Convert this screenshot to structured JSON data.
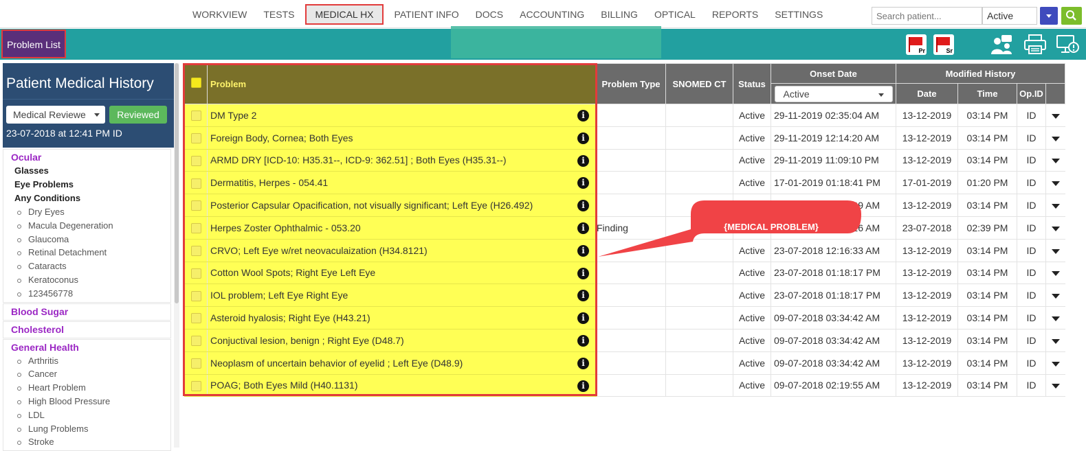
{
  "nav": {
    "items": [
      "WORKVIEW",
      "TESTS",
      "MEDICAL HX",
      "PATIENT INFO",
      "DOCS",
      "ACCOUNTING",
      "BILLING",
      "OPTICAL",
      "REPORTS",
      "SETTINGS"
    ],
    "active_index": 2,
    "search_placeholder": "Search patient...",
    "status_value": "Active"
  },
  "toolbar": {
    "problem_list_label": "Problem List",
    "flag_pr": "Pr",
    "flag_sr": "Sr"
  },
  "sidebar": {
    "title": "Patient Medical History",
    "review_dropdown": "Medical Reviewe",
    "reviewed_button": "Reviewed",
    "review_date": "23-07-2018 at 12:41 PM ID",
    "sections": [
      {
        "label": "Ocular",
        "subs": [
          "Glasses",
          "Eye Problems",
          "Any Conditions"
        ],
        "items": [
          "Dry Eyes",
          "Macula Degeneration",
          "Glaucoma",
          "Retinal Detachment",
          "Cataracts",
          "Keratoconus",
          "123456778"
        ]
      },
      {
        "label": "Blood Sugar",
        "subs": [],
        "items": []
      },
      {
        "label": "Cholesterol",
        "subs": [],
        "items": []
      },
      {
        "label": "General Health",
        "subs": [],
        "items": [
          "Arthritis",
          "Cancer",
          "Heart Problem",
          "High Blood Pressure",
          "LDL",
          "Lung Problems",
          "Stroke"
        ]
      }
    ]
  },
  "table": {
    "headers": {
      "problem": "Problem",
      "problem_type": "Problem Type",
      "snomed": "SNOMED CT",
      "status": "Status",
      "onset_date": "Onset Date",
      "modified_history": "Modified History",
      "date": "Date",
      "time": "Time",
      "opid": "Op.ID"
    },
    "onset_filter": "Active",
    "rows": [
      {
        "problem": "DM Type 2",
        "type": "",
        "snomed": "",
        "status": "Active",
        "onset": "29-11-2019 02:35:04 AM",
        "date": "13-12-2019",
        "time": "03:14 PM",
        "opid": "ID"
      },
      {
        "problem": "Foreign Body, Cornea; Both Eyes",
        "type": "",
        "snomed": "",
        "status": "Active",
        "onset": "29-11-2019 12:14:20 AM",
        "date": "13-12-2019",
        "time": "03:14 PM",
        "opid": "ID"
      },
      {
        "problem": "ARMD DRY [ICD-10: H35.31--, ICD-9: 362.51] ; Both Eyes (H35.31--)",
        "type": "",
        "snomed": "",
        "status": "Active",
        "onset": "29-11-2019 11:09:10 PM",
        "date": "13-12-2019",
        "time": "03:14 PM",
        "opid": "ID"
      },
      {
        "problem": "Dermatitis, Herpes - 054.41",
        "type": "",
        "snomed": "",
        "status": "Active",
        "onset": "17-01-2019 01:18:41 PM",
        "date": "17-01-2019",
        "time": "01:20 PM",
        "opid": "ID"
      },
      {
        "problem": "Posterior Capsular Opacification, not visually significant; Left Eye (H26.492)",
        "type": "",
        "snomed": "",
        "status": "Active",
        "onset": "23-07-2018 02:14:09 AM",
        "date": "13-12-2019",
        "time": "03:14 PM",
        "opid": "ID"
      },
      {
        "problem": "Herpes Zoster Ophthalmic - 053.20",
        "type": "Finding",
        "snomed": "",
        "status": "Active",
        "onset": "23-07-2018 12:41:26 AM",
        "date": "23-07-2018",
        "time": "02:39 PM",
        "opid": "ID"
      },
      {
        "problem": "CRVO; Left Eye w/ret neovaculaization (H34.8121)",
        "type": "",
        "snomed": "",
        "status": "Active",
        "onset": "23-07-2018 12:16:33 AM",
        "date": "13-12-2019",
        "time": "03:14 PM",
        "opid": "ID"
      },
      {
        "problem": "Cotton Wool Spots; Right Eye Left Eye",
        "type": "",
        "snomed": "",
        "status": "Active",
        "onset": "23-07-2018 01:18:17 PM",
        "date": "13-12-2019",
        "time": "03:14 PM",
        "opid": "ID"
      },
      {
        "problem": "IOL problem; Left Eye Right Eye",
        "type": "",
        "snomed": "",
        "status": "Active",
        "onset": "23-07-2018 01:18:17 PM",
        "date": "13-12-2019",
        "time": "03:14 PM",
        "opid": "ID"
      },
      {
        "problem": "Asteroid hyalosis; Right Eye (H43.21)",
        "type": "",
        "snomed": "",
        "status": "Active",
        "onset": "09-07-2018 03:34:42 AM",
        "date": "13-12-2019",
        "time": "03:14 PM",
        "opid": "ID"
      },
      {
        "problem": "Conjuctival lesion, benign ; Right Eye (D48.7)",
        "type": "",
        "snomed": "",
        "status": "Active",
        "onset": "09-07-2018 03:34:42 AM",
        "date": "13-12-2019",
        "time": "03:14 PM",
        "opid": "ID"
      },
      {
        "problem": "Neoplasm of uncertain behavior of eyelid ; Left Eye (D48.9)",
        "type": "",
        "snomed": "",
        "status": "Active",
        "onset": "09-07-2018 03:34:42 AM",
        "date": "13-12-2019",
        "time": "03:14 PM",
        "opid": "ID"
      },
      {
        "problem": "POAG; Both Eyes Mild (H40.1131)",
        "type": "",
        "snomed": "",
        "status": "Active",
        "onset": "09-07-2018 02:19:55 AM",
        "date": "13-12-2019",
        "time": "03:14 PM",
        "opid": "ID"
      }
    ]
  },
  "callout": {
    "label": "{MEDICAL PROBLEM}"
  },
  "colors": {
    "teal_bar": "#22a0a0",
    "sidebar_header": "#2c4d73",
    "highlight_yellow": "#ffff55",
    "callout_red": "#f04346",
    "section_purple": "#9b27c4"
  }
}
